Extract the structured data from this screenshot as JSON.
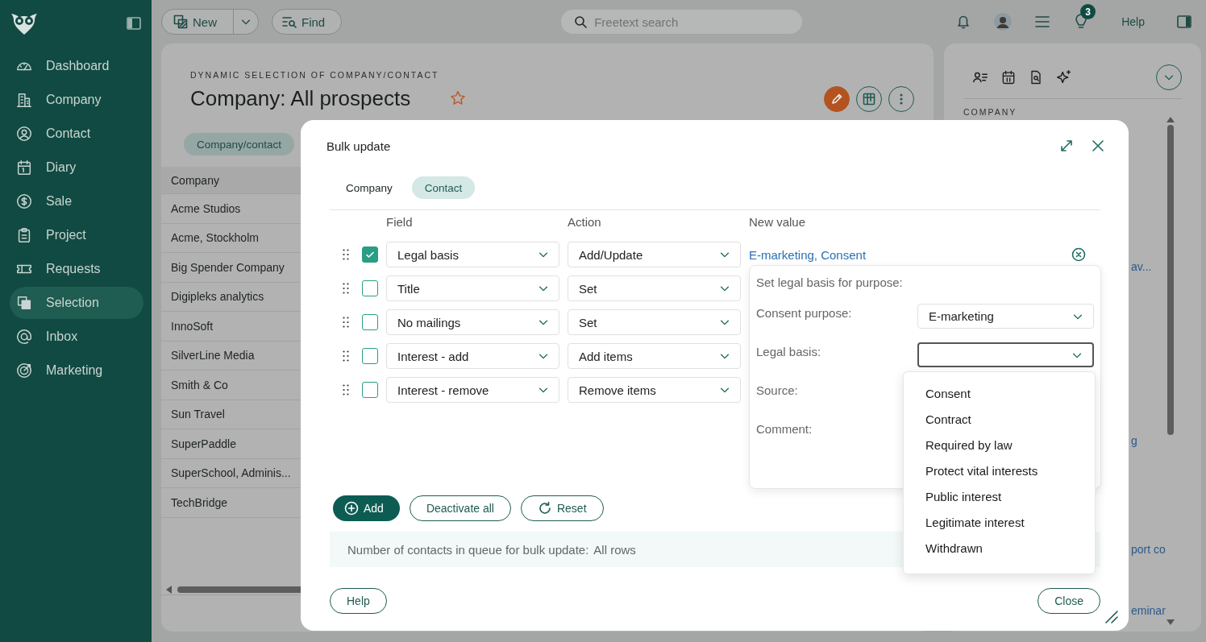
{
  "sidebar": {
    "items": [
      {
        "label": "Dashboard",
        "selected": false
      },
      {
        "label": "Company",
        "selected": false
      },
      {
        "label": "Contact",
        "selected": false
      },
      {
        "label": "Diary",
        "selected": false
      },
      {
        "label": "Sale",
        "selected": false
      },
      {
        "label": "Project",
        "selected": false
      },
      {
        "label": "Requests",
        "selected": false
      },
      {
        "label": "Selection",
        "selected": true
      },
      {
        "label": "Inbox",
        "selected": false
      },
      {
        "label": "Marketing",
        "selected": false
      }
    ]
  },
  "toolbar": {
    "new_button": "New",
    "find_button": "Find",
    "search": {
      "placeholder": "Freetext search"
    },
    "notification_count": "3",
    "help": "Help"
  },
  "selection": {
    "subtitle": "DYNAMIC SELECTION OF COMPANY/CONTACT",
    "title": "Company: All prospects",
    "tabs": [
      {
        "label": "Company/contact",
        "selected": true
      }
    ],
    "table": {
      "columns": [
        "Company"
      ],
      "rows": [
        [
          "Acme Studios"
        ],
        [
          "Acme, Stockholm"
        ],
        [
          "Big Spender Company"
        ],
        [
          "Digipleks analytics"
        ],
        [
          "InnoSoft"
        ],
        [
          "SilverLine Media"
        ],
        [
          "Smith & Co"
        ],
        [
          "Sun Travel"
        ],
        [
          "SuperPaddle"
        ],
        [
          "SuperSchool, Adminis..."
        ],
        [
          "TechBridge"
        ]
      ]
    }
  },
  "right_panel": {
    "section_title": "COMPANY",
    "links": [
      "av...",
      "g",
      "port co",
      "eminar"
    ]
  },
  "dialog": {
    "title": "Bulk update",
    "tabs": [
      {
        "label": "Company",
        "selected": false
      },
      {
        "label": "Contact",
        "selected": true
      }
    ],
    "columns": [
      "Field",
      "Action",
      "New value"
    ],
    "rows": [
      {
        "checked": true,
        "field": "Legal basis",
        "action": "Add/Update",
        "new_value": "E-marketing, Consent"
      },
      {
        "checked": false,
        "field": "Title",
        "action": "Set"
      },
      {
        "checked": false,
        "field": "No mailings",
        "action": "Set"
      },
      {
        "checked": false,
        "field": "Interest - add",
        "action": "Add items"
      },
      {
        "checked": false,
        "field": "Interest - remove",
        "action": "Remove items"
      }
    ],
    "popover": {
      "heading": "Set legal basis for purpose:",
      "fields": [
        {
          "label": "Consent purpose:",
          "kind": "select",
          "value": "E-marketing",
          "focused": false
        },
        {
          "label": "Legal basis:",
          "kind": "select",
          "focused": true
        },
        {
          "label": "Source:"
        },
        {
          "label": "Comment:"
        }
      ]
    },
    "dropdown": {
      "options": [
        "Consent",
        "Contract",
        "Required by law",
        "Protect vital interests",
        "Public interest",
        "Legitimate interest",
        "Withdrawn"
      ]
    },
    "buttons": [
      {
        "label": "Add",
        "kind": "primary"
      },
      {
        "label": "Deactivate all",
        "kind": "outline"
      },
      {
        "label": "Reset",
        "kind": "reset"
      }
    ],
    "queue_info": {
      "label": "Number of contacts in queue for bulk update:",
      "value": "All rows"
    },
    "footer": {
      "help": "Help",
      "close": "Close"
    }
  }
}
